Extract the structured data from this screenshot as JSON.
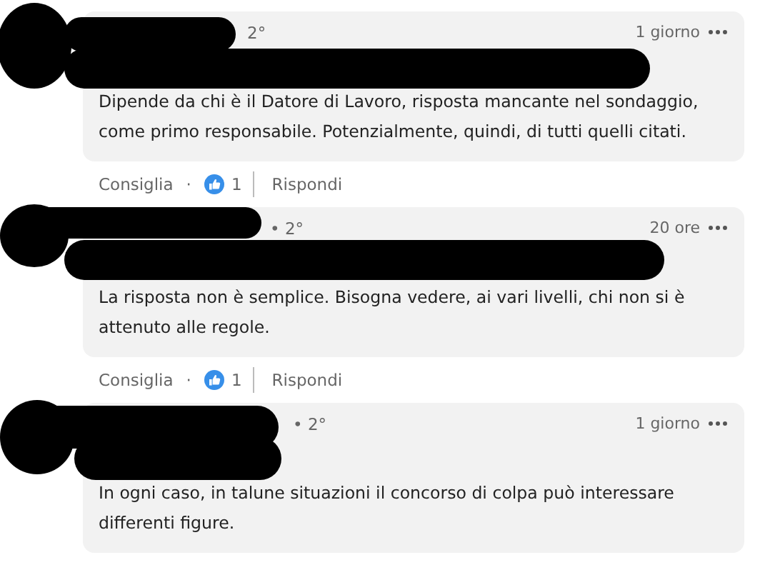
{
  "comments": [
    {
      "degree": "2°",
      "time": "1 giorno",
      "text": "Dipende da chi è il Datore di Lavoro, risposta mancante nel sondaggio, come primo responsabile. Potenzialmente, quindi, di tutti quelli citati.",
      "actions": {
        "like": "Consiglia",
        "separator": "·",
        "count": "1",
        "reply": "Rispondi"
      }
    },
    {
      "degree": "• 2°",
      "time": "20 ore",
      "text": "La risposta non è semplice. Bisogna vedere, ai vari livelli, chi non si è attenuto alle regole.",
      "actions": {
        "like": "Consiglia",
        "separator": "·",
        "count": "1",
        "reply": "Rispondi"
      }
    },
    {
      "degree": "• 2°",
      "time": "1 giorno",
      "text": "In ogni caso, in talune situazioni il concorso di colpa può interessare differenti figure."
    }
  ]
}
